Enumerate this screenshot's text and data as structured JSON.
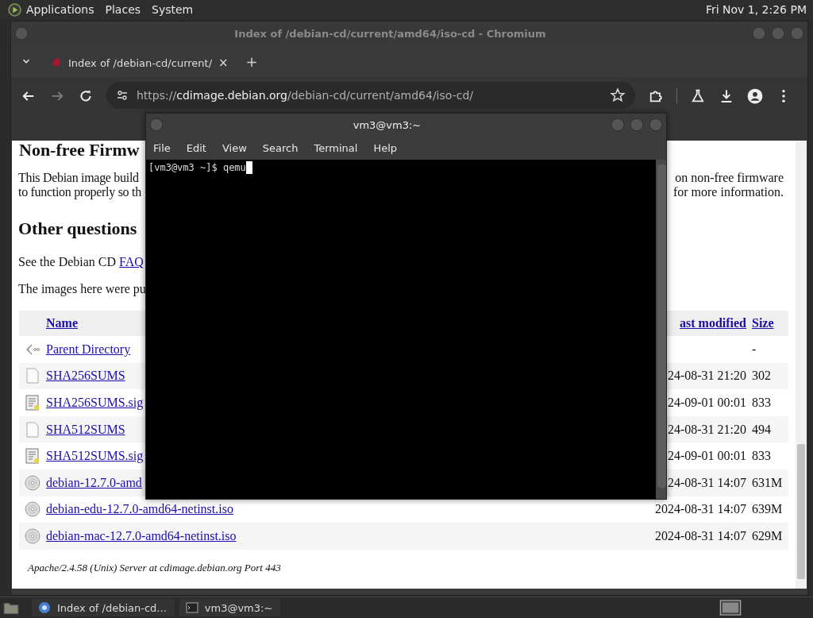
{
  "top_panel": {
    "menus": [
      "Applications",
      "Places",
      "System"
    ],
    "clock": "Fri Nov 1, 2:26 PM"
  },
  "browser": {
    "title": "Index of /debian-cd/current/amd64/iso-cd - Chromium",
    "tab": {
      "label": "Index of /debian-cd/current/",
      "close": "×",
      "new_tab": "+"
    },
    "url": {
      "scheme": "https://",
      "host": "cdimage.debian.org",
      "path": "/debian-cd/current/amd64/iso-cd/"
    },
    "page": {
      "heading_1": "Non-free Firmw",
      "para_lines": [
        {
          "left": "This Debian image build",
          "right": "on non-free firmware"
        },
        {
          "left": "to function properly so th",
          "right": "for more information."
        }
      ],
      "heading_2": "Other questions",
      "faq_text": "See the Debian CD ",
      "faq_link": "FAQ",
      "images_text": "The images here were pu",
      "table": {
        "columns": {
          "name": "Name",
          "modified": "ast modified",
          "size": "Size"
        },
        "rows": [
          {
            "kind": "parent",
            "name": "Parent Directory",
            "modified": "",
            "size": "-"
          },
          {
            "kind": "text",
            "name": "SHA256SUMS",
            "modified": "24-08-31 21:20",
            "size": "302"
          },
          {
            "kind": "sig",
            "name": "SHA256SUMS.sig",
            "modified": "24-09-01 00:01",
            "size": "833"
          },
          {
            "kind": "text",
            "name": "SHA512SUMS",
            "modified": "24-08-31 21:20",
            "size": "494"
          },
          {
            "kind": "sig",
            "name": "SHA512SUMS.sig",
            "modified": "24-09-01 00:01",
            "size": "833"
          },
          {
            "kind": "disc",
            "name": "debian-12.7.0-amd",
            "modified": "24-08-31 14:07",
            "size": "631M"
          },
          {
            "kind": "disc",
            "name": "debian-edu-12.7.0-amd64-netinst.iso",
            "modified": "2024-08-31 14:07",
            "size": "639M"
          },
          {
            "kind": "disc",
            "name": "debian-mac-12.7.0-amd64-netinst.iso",
            "modified": "2024-08-31 14:07",
            "size": "629M"
          }
        ]
      },
      "footer": "Apache/2.4.58 (Unix) Server at cdimage.debian.org Port 443"
    }
  },
  "terminal": {
    "title": "vm3@vm3:~",
    "menus": [
      "File",
      "Edit",
      "View",
      "Search",
      "Terminal",
      "Help"
    ],
    "prompt": "[vm3@vm3 ~]$ qemu"
  },
  "taskbar": {
    "tasks": [
      {
        "kind": "browser",
        "label": "Index of /debian-cd..."
      },
      {
        "kind": "terminal",
        "label": "vm3@vm3:~"
      }
    ]
  }
}
